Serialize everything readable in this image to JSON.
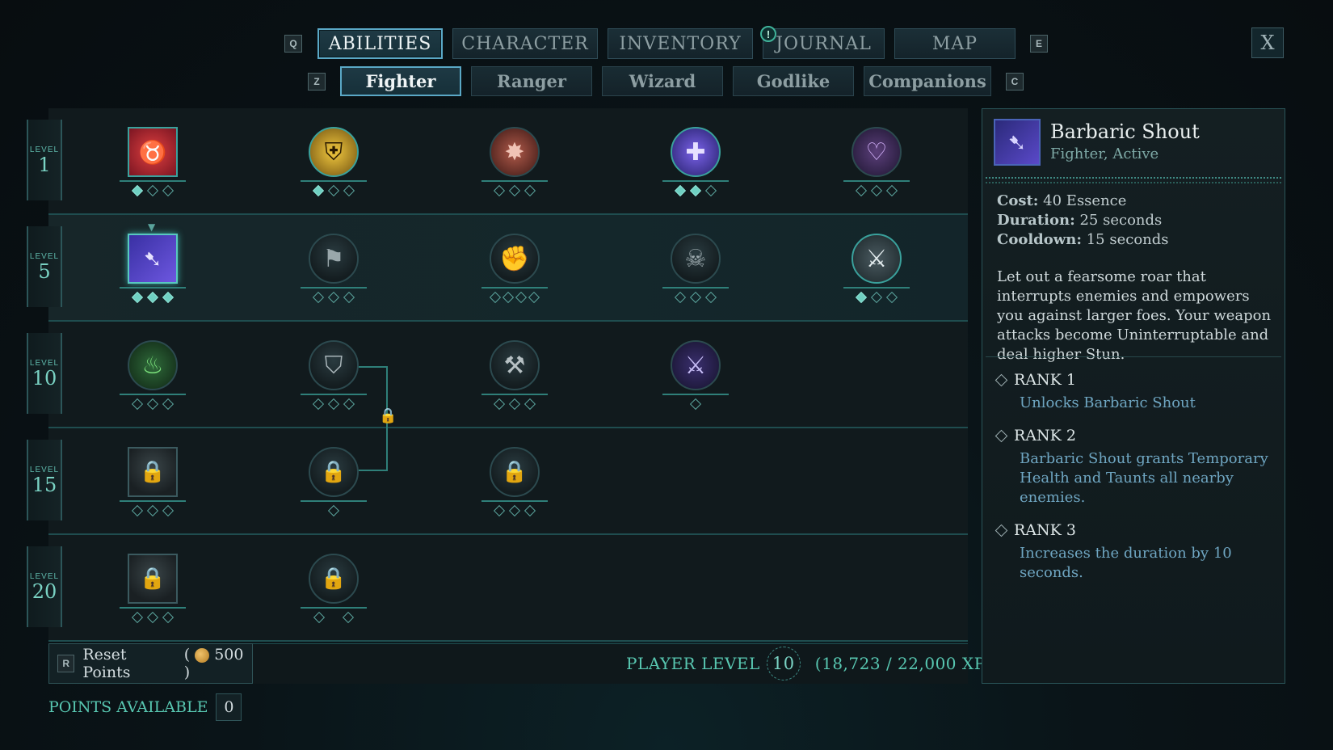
{
  "nav": {
    "key_left": "Q",
    "key_right": "E",
    "tabs": [
      "ABILITIES",
      "CHARACTER",
      "INVENTORY",
      "JOURNAL",
      "MAP"
    ],
    "journal_alert": "!",
    "close": "X"
  },
  "subnav": {
    "key_left": "Z",
    "key_right": "C",
    "tabs": [
      "Fighter",
      "Ranger",
      "Wizard",
      "Godlike",
      "Companions"
    ]
  },
  "tree": {
    "level_word": "LEVEL",
    "levels": [
      "1",
      "5",
      "10",
      "15",
      "20"
    ]
  },
  "icons": {
    "row1": [
      "bull-skull-icon",
      "golden-shield-icon",
      "spiked-shield-icon",
      "plus-cross-icon",
      "purple-heart-icon"
    ],
    "row5": [
      "barbaric-shout-icon",
      "axe-banner-icon",
      "fist-punch-icon",
      "skull-hammer-icon",
      "double-axe-icon"
    ],
    "row10": [
      "green-flame-icon",
      "sword-shield-icon",
      "hammer-strike-icon",
      "crossed-swords-icon"
    ],
    "row15": [
      "locked-ability-icon",
      "locked-ability-icon",
      "locked-ability-icon"
    ],
    "row20": [
      "locked-ability-icon",
      "locked-ability-icon"
    ]
  },
  "bottom": {
    "reset_key": "R",
    "reset_label": "Reset Points",
    "reset_cost": "500",
    "player_level_label": "PLAYER LEVEL",
    "player_level": "10",
    "xp": "(18,723 / 22,000 XP)",
    "points_label": "POINTS AVAILABLE",
    "points_value": "0"
  },
  "detail": {
    "title": "Barbaric Shout",
    "subtitle": "Fighter, Active",
    "cost_label": "Cost:",
    "cost_value": "40 Essence",
    "duration_label": "Duration:",
    "duration_value": "25 seconds",
    "cooldown_label": "Cooldown:",
    "cooldown_value": "15 seconds",
    "description": "Let out a fearsome roar that interrupts enemies and empowers you against larger foes. Your weapon attacks become Uninterruptable and deal higher Stun.",
    "ranks": [
      {
        "label": "RANK 1",
        "text": "Unlocks Barbaric Shout"
      },
      {
        "label": "RANK 2",
        "text": "Barbaric Shout grants Temporary Health and Taunts all nearby enemies."
      },
      {
        "label": "RANK 3",
        "text": "Increases the duration by 10 seconds."
      }
    ]
  }
}
